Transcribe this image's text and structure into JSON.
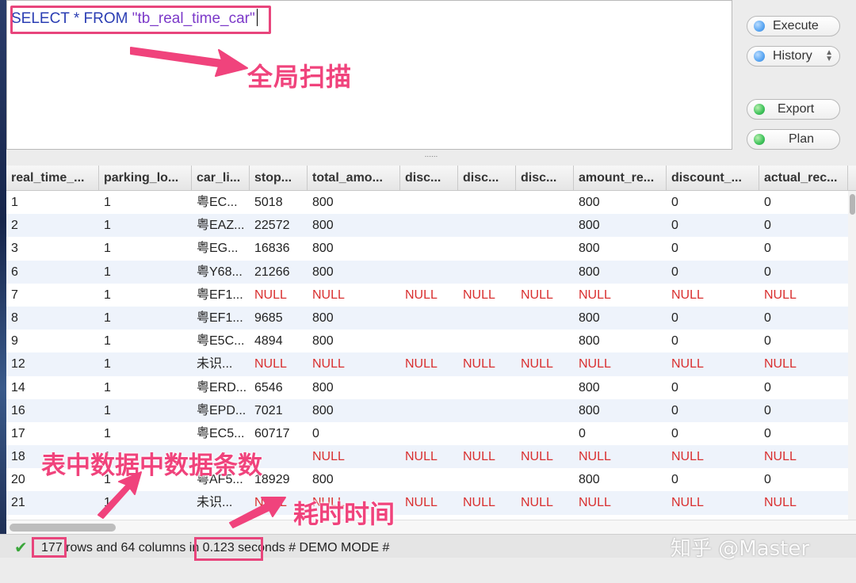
{
  "editor": {
    "sql_keyword": "SELECT * FROM ",
    "sql_string": "\"tb_real_time_car\""
  },
  "buttons": {
    "execute": "Execute",
    "history": "History",
    "export": "Export",
    "plan": "Plan"
  },
  "splitter_grip": "......",
  "grid": {
    "columns": [
      "real_time_...",
      "parking_lo...",
      "car_li...",
      "stop...",
      "total_amo...",
      "disc...",
      "disc...",
      "disc...",
      "amount_re...",
      "discount_...",
      "actual_rec..."
    ],
    "rows": [
      [
        "1",
        "1",
        "粤EC...",
        "5018",
        "800",
        "",
        "",
        "",
        "800",
        "0",
        "0"
      ],
      [
        "2",
        "1",
        "粤EAZ...",
        "22572",
        "800",
        "",
        "",
        "",
        "800",
        "0",
        "0"
      ],
      [
        "3",
        "1",
        "粤EG...",
        "16836",
        "800",
        "",
        "",
        "",
        "800",
        "0",
        "0"
      ],
      [
        "6",
        "1",
        "粤Y68...",
        "21266",
        "800",
        "",
        "",
        "",
        "800",
        "0",
        "0"
      ],
      [
        "7",
        "1",
        "粤EF1...",
        "NULL",
        "NULL",
        "NULL",
        "NULL",
        "NULL",
        "NULL",
        "NULL",
        "NULL"
      ],
      [
        "8",
        "1",
        "粤EF1...",
        "9685",
        "800",
        "",
        "",
        "",
        "800",
        "0",
        "0"
      ],
      [
        "9",
        "1",
        "粤E5C...",
        "4894",
        "800",
        "",
        "",
        "",
        "800",
        "0",
        "0"
      ],
      [
        "12",
        "1",
        "未识...",
        "NULL",
        "NULL",
        "NULL",
        "NULL",
        "NULL",
        "NULL",
        "NULL",
        "NULL"
      ],
      [
        "14",
        "1",
        "粤ERD...",
        "6546",
        "800",
        "",
        "",
        "",
        "800",
        "0",
        "0"
      ],
      [
        "16",
        "1",
        "粤EPD...",
        "7021",
        "800",
        "",
        "",
        "",
        "800",
        "0",
        "0"
      ],
      [
        "17",
        "1",
        "粤EC5...",
        "60717",
        "0",
        "",
        "",
        "",
        "0",
        "0",
        "0"
      ],
      [
        "18",
        "1",
        "",
        "",
        "NULL",
        "NULL",
        "NULL",
        "NULL",
        "NULL",
        "NULL",
        "NULL"
      ],
      [
        "20",
        "1",
        "粤AF5...",
        "18929",
        "800",
        "",
        "",
        "",
        "800",
        "0",
        "0"
      ],
      [
        "21",
        "1",
        "未识...",
        "NULL",
        "NULL",
        "NULL",
        "NULL",
        "NULL",
        "NULL",
        "NULL",
        "NULL"
      ]
    ]
  },
  "status": {
    "rows_count": "177",
    "text_after_rows": " rows and 64 columns ",
    "time_text": "in 0.123",
    "text_after_time": " seconds # DEMO MODE #"
  },
  "annotations": {
    "scan": "全局扫描",
    "row_count": "表中数据中数据条数",
    "elapsed": "耗时时间"
  },
  "watermark": "知乎 @Master"
}
